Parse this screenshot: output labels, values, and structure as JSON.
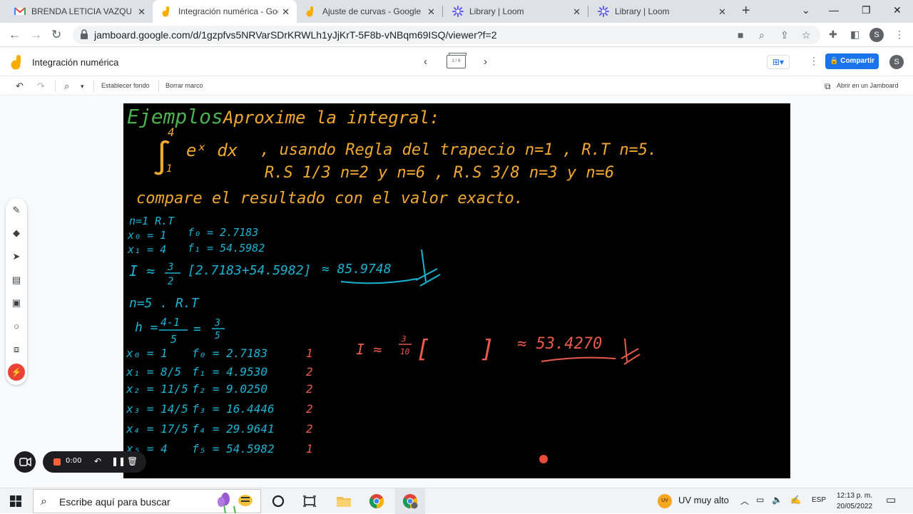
{
  "browser": {
    "tabs": [
      {
        "title": "BRENDA LETICIA VAZQUEZ C",
        "icon": "gmail-icon",
        "active": false
      },
      {
        "title": "Integración numérica - Goog",
        "icon": "jamboard-icon",
        "active": true
      },
      {
        "title": "Ajuste de curvas - Google Jar",
        "icon": "jamboard-icon",
        "active": false
      },
      {
        "title": "Library | Loom",
        "icon": "loom-icon",
        "active": false
      },
      {
        "title": "Library | Loom",
        "icon": "loom-icon",
        "active": false
      }
    ],
    "new_tab_label": "+",
    "close_glyph": "✕",
    "url": "jamboard.google.com/d/1gzpfvs5NRVarSDrKRWLh1yJjKrT-5F8b-vNBqm69ISQ/viewer?f=2",
    "profile_initial": "S"
  },
  "jamboard": {
    "title": "Integración numérica",
    "frame_indicator": "2 / 9",
    "share_label": "Compartir",
    "profile_initial": "S",
    "toolbar": {
      "set_background": "Establecer fondo",
      "clear_frame": "Borrar marco",
      "open_in_jamboard": "Abrir en un Jamboard"
    },
    "colors": {
      "board_background": "#000000",
      "green_ink": "#4caf50",
      "orange_ink": "#f0a830",
      "cyan_ink": "#1ab3d1",
      "red_ink": "#e85a4a",
      "accent": "#1a73e8"
    },
    "board_text": {
      "heading_green": "Ejemplos",
      "heading_orange": "Aproxime la integral:",
      "integral_upper": "4",
      "integral_lower": "1",
      "integrand": "eˣ dx",
      "line1": ", usando Regla del trapecio n=1 , R.T n=5.",
      "line2": "R.S 1/3 n=2 y n=6 , R.S 3/8 n=3 y n=6",
      "line3": "compare el resultado con el valor exacto.",
      "case1": {
        "header": "n=1 R.T",
        "x0": "x₀ = 1",
        "x1": "x₁ = 4",
        "f0": "f₀ = 2.7183",
        "f1": "f₁ = 54.5982",
        "formula_lhs": "I ≈",
        "frac_num": "3",
        "frac_den": "2",
        "bracket": "[2.7183+54.5982]",
        "result": "≈ 85.9748"
      },
      "case2": {
        "header": "n=5 . R.T",
        "h_lhs": "h =",
        "h_num": "4-1",
        "h_den": "5",
        "h_eq": "=",
        "h_res_num": "3",
        "h_res_den": "5",
        "rows": [
          {
            "x": "x₀ = 1",
            "f": "f₀ = 2.7183",
            "w": "1"
          },
          {
            "x": "x₁ = 8/5",
            "f": "f₁ = 4.9530",
            "w": "2"
          },
          {
            "x": "x₂ = 11/5",
            "f": "f₂ = 9.0250",
            "w": "2"
          },
          {
            "x": "x₃ = 14/5",
            "f": "f₃ = 16.4446",
            "w": "2"
          },
          {
            "x": "x₄ = 17/5",
            "f": "f₄ = 29.9641",
            "w": "2"
          },
          {
            "x": "x₅ = 4",
            "f": "f₅ = 54.5982",
            "w": "1"
          }
        ],
        "formula_lhs": "I ≈",
        "frac_num": "3",
        "frac_den": "10",
        "bracket_open": "[",
        "bracket_close": "]",
        "result": "≈ 53.4270"
      }
    }
  },
  "loom": {
    "timer": "0:00"
  },
  "taskbar": {
    "search_placeholder": "Escribe aquí para buscar",
    "weather_badge": "UV",
    "weather": "UV muy alto",
    "language": "ESP",
    "time": "12:13 p. m.",
    "date": "20/05/2022"
  }
}
